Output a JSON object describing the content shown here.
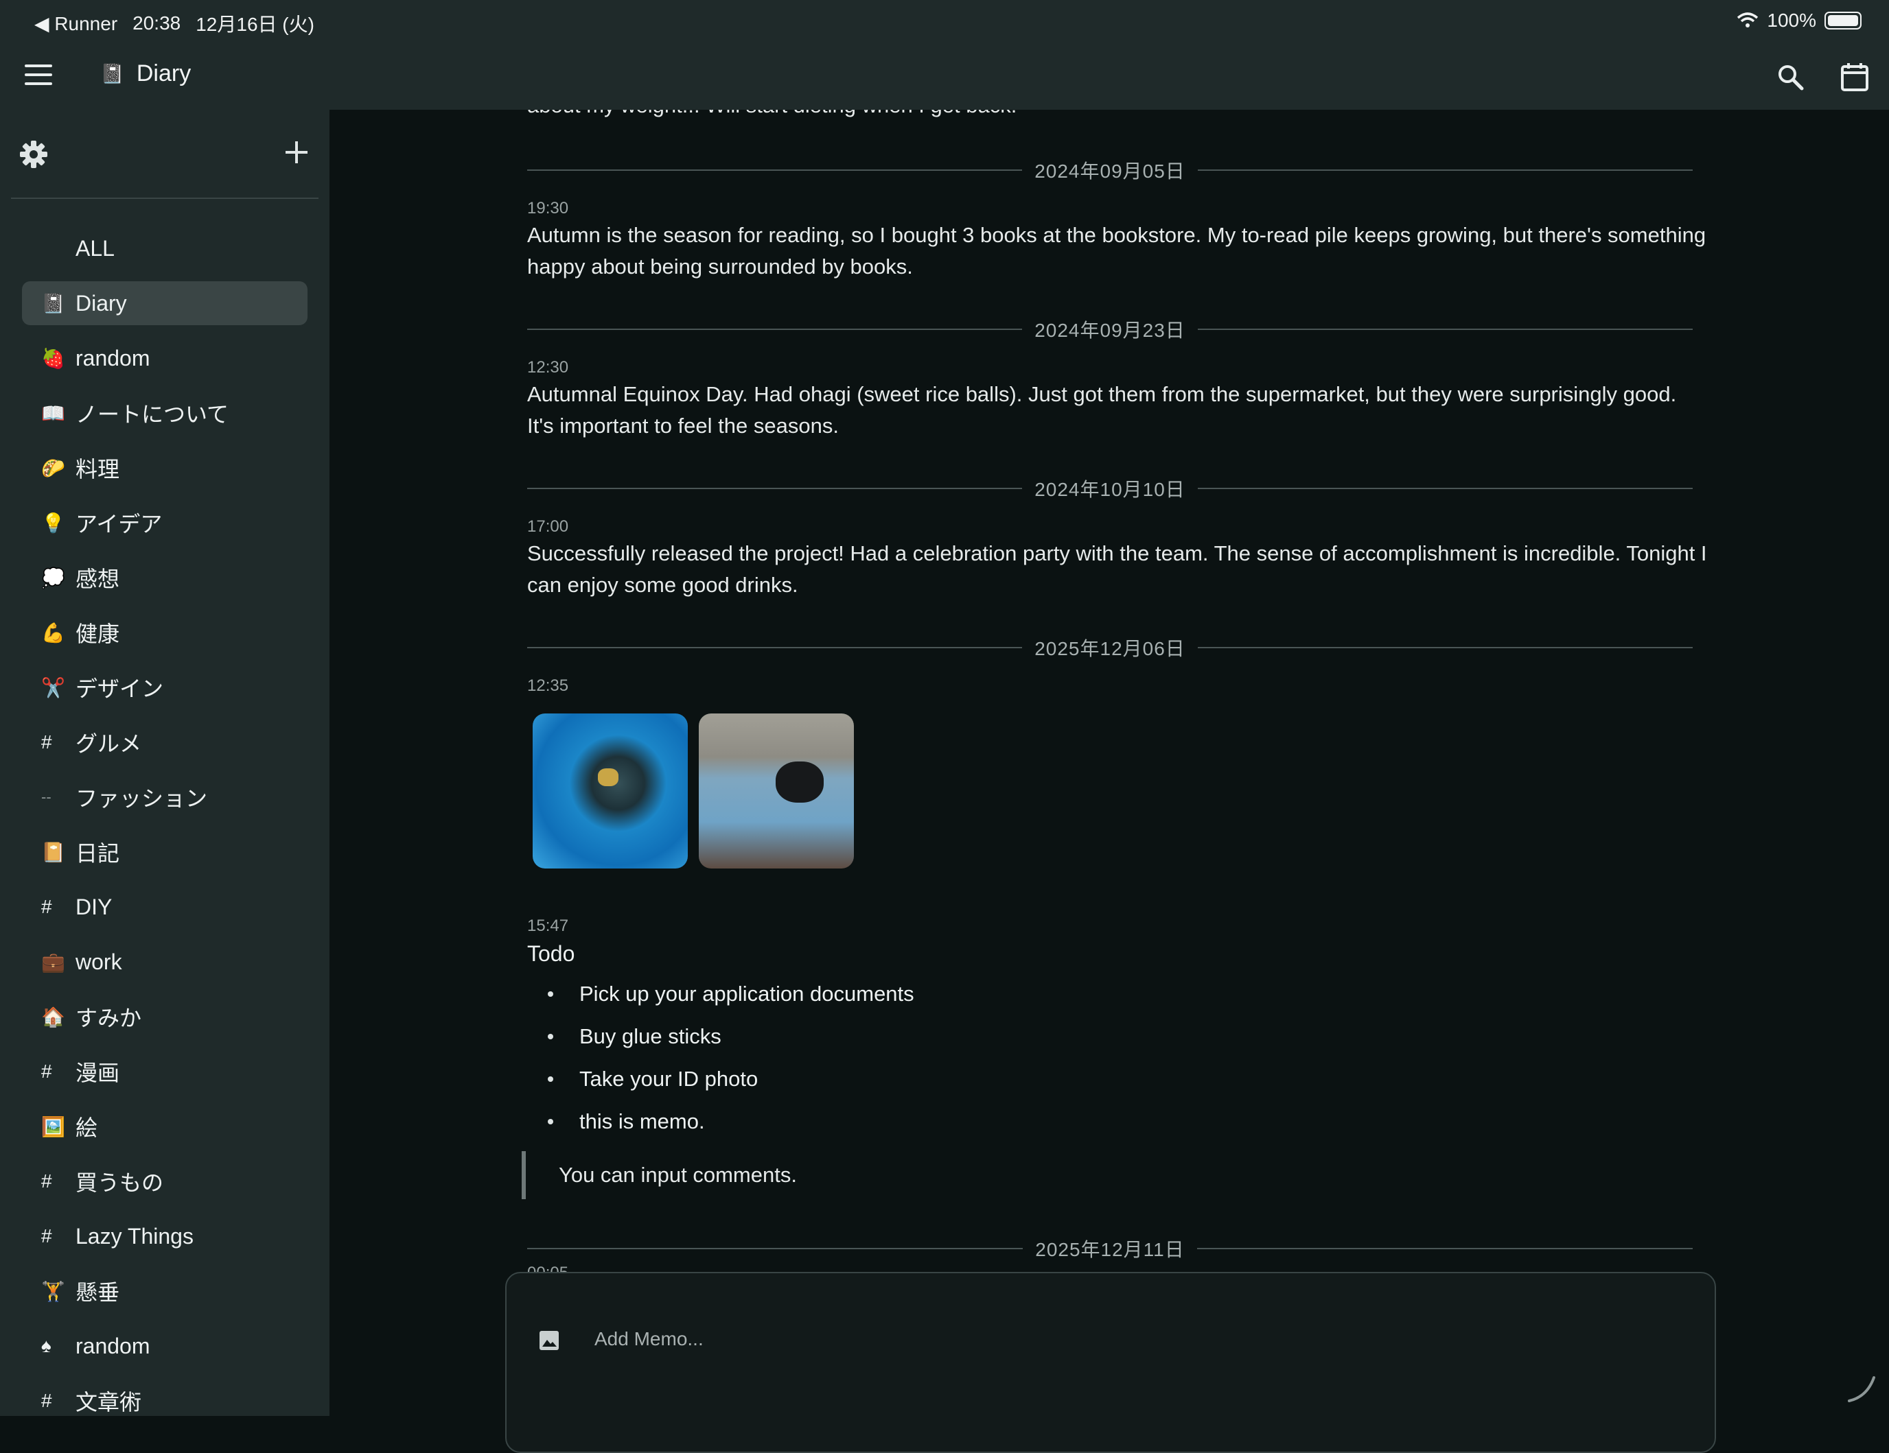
{
  "status_bar": {
    "back_app": "Runner",
    "time": "20:38",
    "date": "12月16日 (火)",
    "battery": "100%"
  },
  "app_bar": {
    "title": "Diary",
    "title_icon": "notebook-icon"
  },
  "sidebar": {
    "items": [
      {
        "icon": "",
        "label": "ALL"
      },
      {
        "icon": "📓",
        "label": "Diary",
        "active": true
      },
      {
        "icon": "🍓",
        "label": "random"
      },
      {
        "icon": "📖",
        "label": "ノートについて"
      },
      {
        "icon": "🌮",
        "label": "料理"
      },
      {
        "icon": "💡",
        "label": "アイデア"
      },
      {
        "icon": "💭",
        "label": "感想"
      },
      {
        "icon": "💪",
        "label": "健康"
      },
      {
        "icon": "✂️",
        "label": "デザイン"
      },
      {
        "icon": "#",
        "label": "グルメ"
      },
      {
        "icon": "--",
        "label": "ファッション"
      },
      {
        "icon": "📔",
        "label": "日記"
      },
      {
        "icon": "#",
        "label": "DIY"
      },
      {
        "icon": "💼",
        "label": "work"
      },
      {
        "icon": "🏠",
        "label": "すみか"
      },
      {
        "icon": "#",
        "label": "漫画"
      },
      {
        "icon": "🖼️",
        "label": "絵"
      },
      {
        "icon": "#",
        "label": "買うもの"
      },
      {
        "icon": "#",
        "label": "Lazy Things"
      },
      {
        "icon": "🏋",
        "label": "懸垂"
      },
      {
        "icon": "♠",
        "label": "random"
      },
      {
        "icon": "#",
        "label": "文章術"
      }
    ]
  },
  "feed": {
    "cut_text": "about my weight... Will start dieting when I get back.",
    "entries": [
      {
        "date": "2024年09月05日",
        "time": "19:30",
        "text": "Autumn is the season for reading, so I bought 3 books at the bookstore. My to-read pile keeps growing, but there's something happy about being surrounded by books."
      },
      {
        "date": "2024年09月23日",
        "time": "12:30",
        "text": "Autumnal Equinox Day. Had ohagi (sweet rice balls). Just got them from the supermarket, but they were surprisingly good. It's important to feel the seasons."
      },
      {
        "date": "2024年10月10日",
        "time": "17:00",
        "text": "Successfully released the project! Had a celebration party with the team. The sense of accomplishment is incredible. Tonight I can enjoy some good drinks."
      },
      {
        "date": "2025年12月06日",
        "time": "12:35",
        "photos": [
          "penguin-underwater-photo",
          "penguin-poolside-photo"
        ]
      },
      {
        "time": "15:47",
        "title": "Todo",
        "bullets": [
          "Pick up your application documents",
          "Buy glue sticks",
          "Take your ID photo",
          "this is memo."
        ],
        "quote": "You can input comments."
      },
      {
        "date": "2025年12月11日",
        "time": "00:05"
      }
    ]
  },
  "composer": {
    "placeholder": "Add Memo..."
  },
  "colors": {
    "background": "#0b1212",
    "sidebar": "#1f2a2a",
    "active_item": "#3a4545",
    "text": "#e6eaea"
  }
}
